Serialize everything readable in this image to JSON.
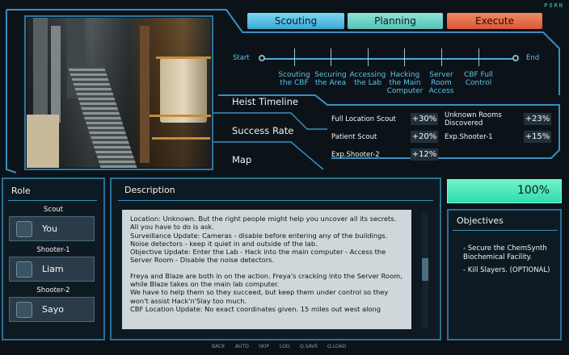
{
  "brand": {
    "logo": "PORN"
  },
  "tabs": [
    {
      "label": "Scouting",
      "color": "#5dc3e8"
    },
    {
      "label": "Planning",
      "color": "#74d5c9"
    },
    {
      "label": "Execute",
      "color": "#e56a45"
    }
  ],
  "timeline": {
    "start_label": "Start",
    "end_label": "End",
    "steps": [
      {
        "label": "Scouting the CBF"
      },
      {
        "label": "Securing the Area"
      },
      {
        "label": "Accessing the Lab"
      },
      {
        "label": "Hacking the Main Computer"
      },
      {
        "label": "Server Room Access"
      },
      {
        "label": "CBF Full Control"
      }
    ]
  },
  "menu": {
    "timeline": "Heist Timeline",
    "success": "Success Rate",
    "map": "Map"
  },
  "success_rates": [
    {
      "label": "Full Location Scout",
      "value": "+30%"
    },
    {
      "label": "Unknown Rooms Discovered",
      "value": "+23%"
    },
    {
      "label": "Patient Scout",
      "value": "+20%"
    },
    {
      "label": "Exp.Shooter-1",
      "value": "+15%"
    },
    {
      "label": "Exp.Shooter-2",
      "value": "+12%"
    }
  ],
  "role_panel": {
    "title": "Role",
    "roles": [
      {
        "role": "Scout",
        "name": "You"
      },
      {
        "role": "Shooter-1",
        "name": "Liam"
      },
      {
        "role": "Shooter-2",
        "name": "Sayo"
      }
    ]
  },
  "description_panel": {
    "title": "Description",
    "paragraphs": [
      "Location: Unknown. But the right people might help you uncover all its secrets. All you have to do is ask.",
      "Surveillance Update: Cameras - disable before entering any of the buildings.",
      "Noise detectors - keep it quiet in and outside of the lab.",
      "Objective Update: Enter the Lab - Hack into the main computer - Access the Server Room - Disable the noise detectors.",
      "",
      "Freya and Blaze are both in on the action. Freya's cracking into the Server Room, while Blaze takes on the main lab computer.",
      "We have to help them so they succeed, but keep them under control so they won't assist Hack'n'Slay too much.",
      "CBF Location Update: No exact coordinates given. 15 miles out west along"
    ]
  },
  "progress": {
    "value": 1.0,
    "label": "100%"
  },
  "objectives": {
    "title": "Objectives",
    "items": [
      "- Secure the ChemSynth Biochemical Facility.",
      "- Kill Slayers. (OPTIONAL)"
    ]
  },
  "footer": {
    "buttons": [
      "BACK",
      "AUTO",
      "SKIP",
      "LOG",
      "Q.SAVE",
      "Q.LOAD"
    ]
  }
}
